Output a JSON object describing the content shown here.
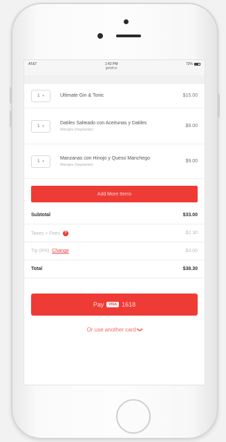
{
  "status": {
    "carrier": "AT&T",
    "time": "1:42 PM",
    "url": "getslice",
    "battery": "72%"
  },
  "items": [
    {
      "qty": "1",
      "name": "Ultimate Gin & Tonic",
      "allergens": "",
      "price": "$15.00"
    },
    {
      "qty": "1",
      "name": "Datiles Salteado con Aceitunas y Datiles",
      "allergens": "Allergies (Vegetarian)",
      "price": "$9.00"
    },
    {
      "qty": "1",
      "name": "Manzanas con Hinojo y Queso Manchego",
      "allergens": "Allergies (Vegetarian)",
      "price": "$9.00"
    }
  ],
  "add_more_label": "Add More Items",
  "summary": {
    "subtotal_label": "Subtotal",
    "subtotal_value": "$33.00",
    "taxes_label": "Taxes + Fees",
    "taxes_value": "$2.30",
    "tip_label": "Tip (8%)",
    "tip_change": "Change",
    "tip_value": "$3.00",
    "total_label": "Total",
    "total_value": "$38.30"
  },
  "pay": {
    "label": "Pay",
    "badge": "VISA",
    "card_last": "1618"
  },
  "alt_card_label": "Or use another card",
  "colors": {
    "accent": "#ef3b36"
  },
  "icons": {
    "qty_dropdown": "chevron-down-icon",
    "help": "question-circle-icon",
    "alt_card": "chevron-down-icon"
  }
}
